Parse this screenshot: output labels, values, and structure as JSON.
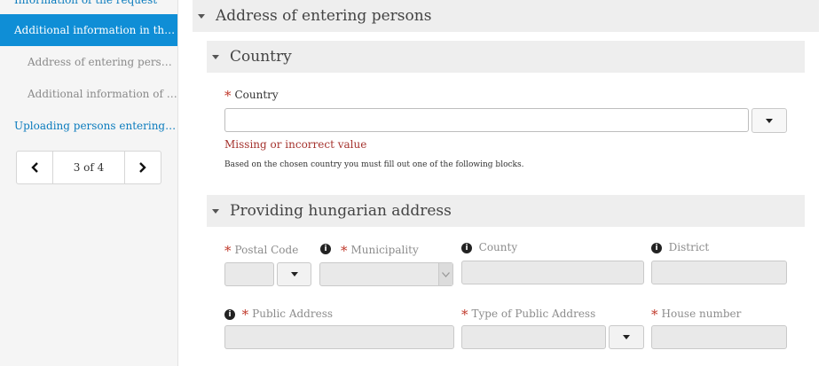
{
  "sidebar": {
    "items": [
      {
        "label": "Information of the request"
      },
      {
        "label": "Additional information in the…"
      },
      {
        "label": "Address of entering persons"
      },
      {
        "label": "Additional information of …"
      },
      {
        "label": "Uploading persons entering t…"
      }
    ],
    "pager": {
      "label": "3 of 4",
      "prev_icon": "chevron-left-icon",
      "next_icon": "chevron-right-icon"
    }
  },
  "main": {
    "section_title": "Address of entering persons",
    "country_section": {
      "title": "Country",
      "field_label": "Country",
      "required_mark": "*",
      "value": "",
      "error": "Missing or incorrect value",
      "hint": "Based on the chosen country you must fill out one of the following blocks."
    },
    "hungarian_section": {
      "title": "Providing hungarian address",
      "info_icon": "i",
      "fields": {
        "postal_code": "Postal Code",
        "municipality": "Municipality",
        "county": "County",
        "district": "District",
        "public_address": "Public Address",
        "type_of_public_address": "Type of Public Address",
        "house_number": "House number"
      }
    }
  },
  "colors": {
    "accent": "#0f8ed6",
    "link": "#0a7bbd",
    "error": "#a5332e",
    "required": "#c0392b"
  }
}
